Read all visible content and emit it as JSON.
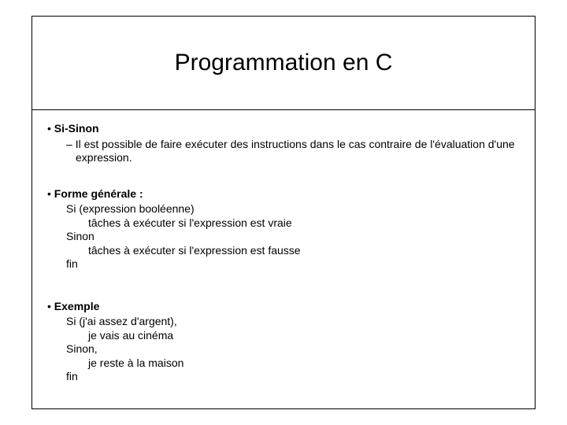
{
  "title": "Programmation en C",
  "section1": {
    "heading": "Si-Sinon",
    "desc": "Il est possible de faire exécuter des instructions dans le cas contraire de l'évaluation d'une expression."
  },
  "section2": {
    "heading": "Forme générale :",
    "l1": "Si (expression booléenne)",
    "l2": "tâches à exécuter si l'expression est vraie",
    "l3": "Sinon",
    "l4": "tâches à exécuter si l'expression est fausse",
    "l5": "fin"
  },
  "section3": {
    "heading": "Exemple",
    "l1": "Si  (j'ai assez d'argent),",
    "l2": "je vais au cinéma",
    "l3": "Sinon,",
    "l4": "je reste à la maison",
    "l5": "fin"
  }
}
